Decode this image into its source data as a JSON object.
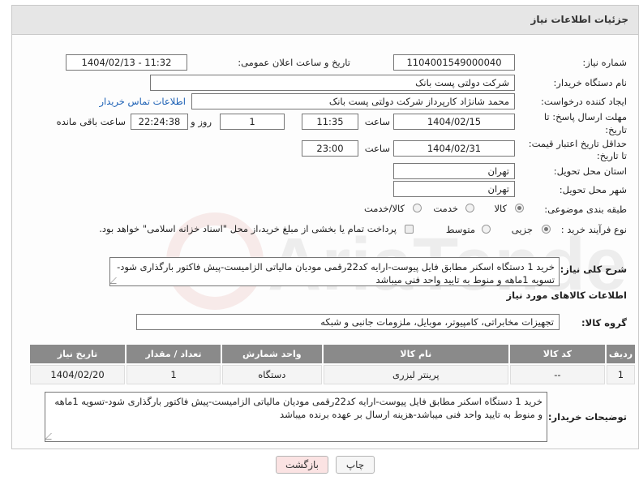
{
  "panel": {
    "title": "جزئیات اطلاعات نیاز"
  },
  "fields": {
    "need_number_label": "شماره نیاز:",
    "need_number": "1104001549000040",
    "announce_label": "تاریخ و ساعت اعلان عمومی:",
    "announce_value": "1404/02/13 - 11:32",
    "buyer_org_label": "نام دستگاه خریدار:",
    "buyer_org": "شرکت دولتی پست بانک",
    "requester_label": "ایجاد کننده درخواست:",
    "requester": "محمد شانژاد کارپرداز شرکت دولتی پست بانک",
    "contact_link": "اطلاعات تماس خریدار",
    "deadline_label_1": "مهلت ارسال پاسخ: تا",
    "deadline_label_2": "تاریخ:",
    "deadline_date": "1404/02/15",
    "hour_label": "ساعت",
    "deadline_time": "11:35",
    "day_count": "1",
    "day_label": "روز و",
    "remaining_time": "22:24:38",
    "remaining_label": "ساعت باقی مانده",
    "validity_label_1": "حداقل تاریخ اعتبار قیمت:",
    "validity_label_2": "تا تاریخ:",
    "validity_date": "1404/02/31",
    "validity_time": "23:00",
    "province_label": "استان محل تحویل:",
    "province": "تهران",
    "city_label": "شهر محل تحویل:",
    "city": "تهران",
    "category_label": "طبقه بندی موضوعی:",
    "category_options": [
      "کالا",
      "خدمت",
      "کالا/خدمت"
    ],
    "process_label": "نوع فرآیند خرید :",
    "process_options": [
      "جزیی",
      "متوسط"
    ],
    "payment_note": "پرداخت تمام یا بخشی از مبلغ خرید،از محل \"اسناد خزانه اسلامی\" خواهد بود."
  },
  "description": {
    "label": "شرح کلی نیاز:",
    "text": "خرید 1 دستگاه اسکنر مطابق فایل پیوست-ارایه کد22رقمی مودیان مالیاتی الزامیست-پیش فاکتور بارگذاری شود-تسویه 1ماهه و منوط به تایید  واحد فنی میباشد"
  },
  "goods": {
    "section_title": "اطلاعات کالاهای مورد نیاز",
    "group_label": "گروه کالا:",
    "group_value": "تجهیزات مخابراتی، کامپیوتر، موبایل، ملزومات جانبی و شبکه"
  },
  "table": {
    "headers": [
      "ردیف",
      "کد کالا",
      "نام کالا",
      "واحد شمارش",
      "تعداد / مقدار",
      "تاریخ نیاز"
    ],
    "rows": [
      {
        "row": "1",
        "code": "--",
        "name": "پرینتر لیزری",
        "unit": "دستگاه",
        "qty": "1",
        "date": "1404/02/20"
      }
    ]
  },
  "buyer_notes": {
    "label": "توضیحات خریدار:",
    "text": "خرید 1 دستگاه اسکنر مطابق فایل پیوست-ارایه کد22رقمی مودیان مالیاتی الزامیست-پیش فاکتور بارگذاری شود-تسویه 1ماهه و منوط به تایید  واحد فنی میباشد-هزینه ارسال بر عهده برنده میباشد"
  },
  "buttons": {
    "print": "چاپ",
    "back": "بازگشت"
  },
  "watermark": {
    "text": "AriaTender.net"
  },
  "colors": {
    "header_bg": "#e6e6e6",
    "table_header": "#8a8a8a",
    "link": "#1a5fb4",
    "back_button_bg": "#fbe3e3"
  }
}
